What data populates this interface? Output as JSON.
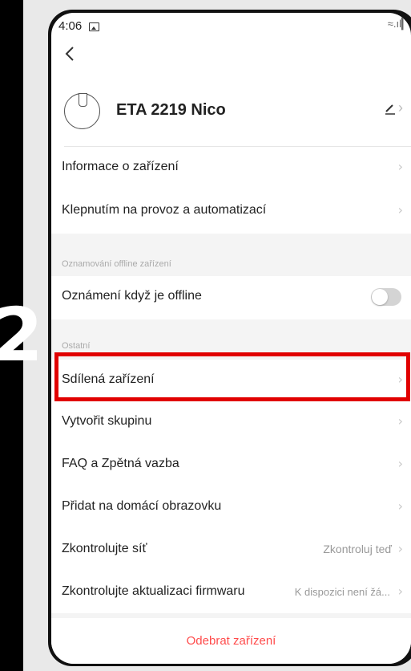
{
  "status_bar": {
    "time": "4:06",
    "right_icons": " ≈.ıl▎"
  },
  "header": {
    "back_icon": "chevron-left-icon",
    "device_name": "ETA 2219 Nico",
    "edit_icon": "pencil-icon"
  },
  "rows_top": [
    {
      "label": "Informace o zařízení"
    },
    {
      "label": "Klepnutím na provoz a automatizací"
    }
  ],
  "offline_section": {
    "title": "Oznamování offline zařízení",
    "row_label": "Oznámení když je offline",
    "toggle_on": false
  },
  "other_section": {
    "title": "Ostatní",
    "rows": [
      {
        "label": "Sdílená zařízení",
        "value": ""
      },
      {
        "label": "Vytvořit skupinu",
        "value": ""
      },
      {
        "label": "FAQ a Zpětná vazba",
        "value": ""
      },
      {
        "label": "Přidat na domácí obrazovku",
        "value": ""
      },
      {
        "label": "Zkontrolujte síť",
        "value": "Zkontroluj teď"
      },
      {
        "label": "Zkontrolujte aktualizaci firmwaru",
        "value": "K dispozici není žá..."
      }
    ]
  },
  "remove_button": {
    "label": "Odebrat zařízení"
  },
  "annotation": {
    "step_number": "2",
    "highlight_color": "#e10000"
  },
  "colors": {
    "accent_red": "#ff4b4b",
    "panel_bg": "#e9e9e9"
  }
}
